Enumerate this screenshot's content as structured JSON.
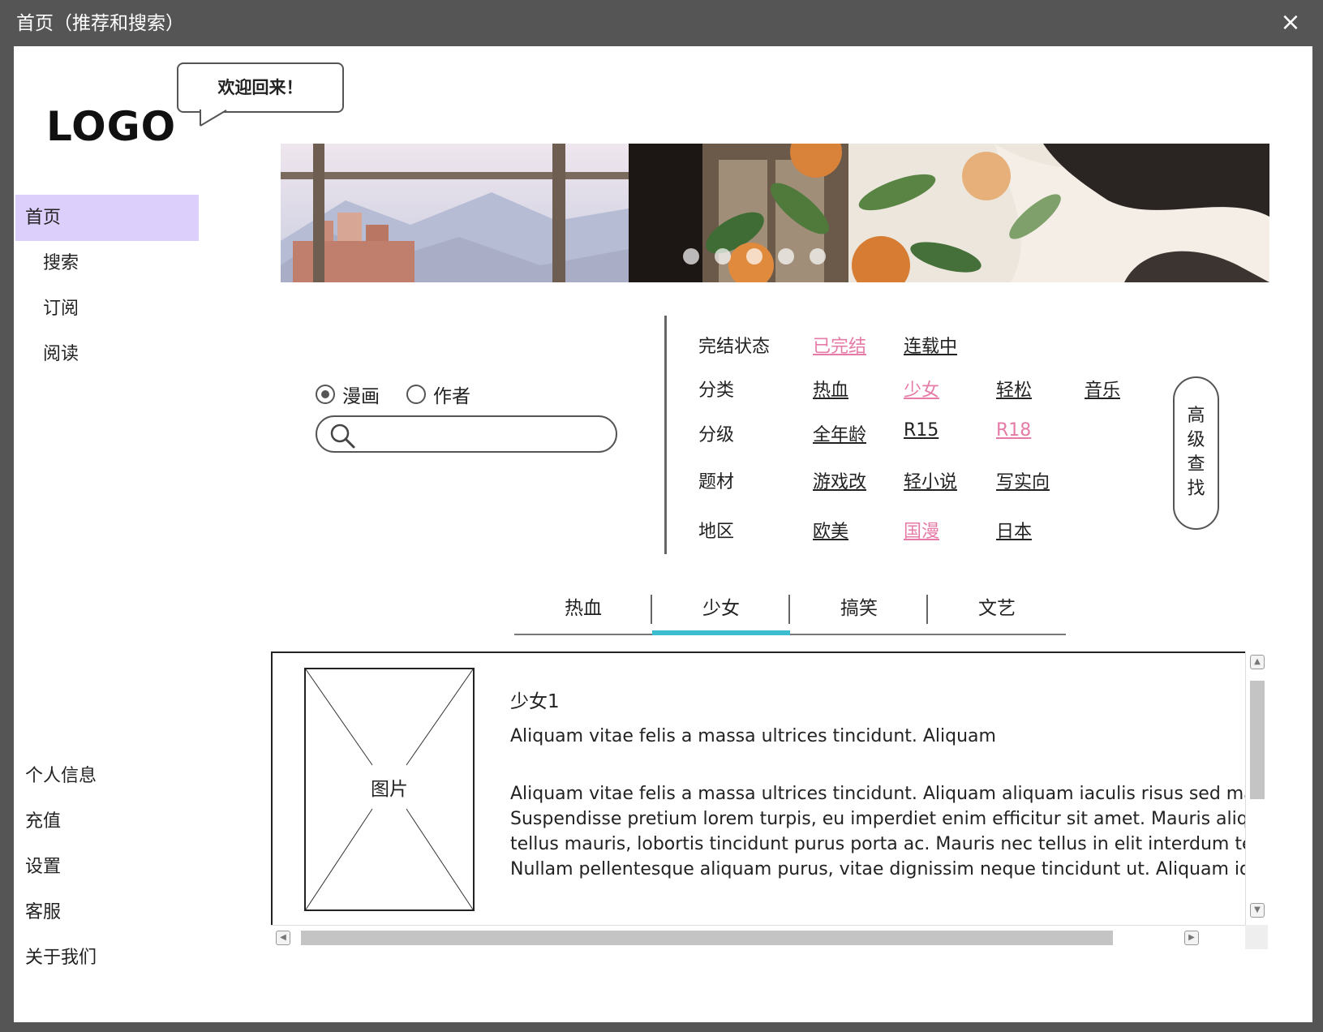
{
  "window": {
    "title": "首页（推荐和搜索）",
    "close_icon": "×"
  },
  "header": {
    "logo": "LOGO",
    "welcome": "欢迎回来！"
  },
  "sidebar": {
    "items": [
      {
        "label": "首页",
        "active": true
      },
      {
        "label": "搜索"
      },
      {
        "label": "订阅"
      },
      {
        "label": "阅读"
      }
    ],
    "bottom_items": [
      {
        "label": "个人信息"
      },
      {
        "label": "充值"
      },
      {
        "label": "设置"
      },
      {
        "label": "客服"
      },
      {
        "label": "关于我们"
      }
    ]
  },
  "banner": {
    "slides": 5,
    "active_slide": 1
  },
  "search": {
    "radio_manga": "漫画",
    "radio_author": "作者",
    "selected": "漫画",
    "placeholder": ""
  },
  "filters": {
    "rows": [
      {
        "label": "完结状态",
        "options": [
          "已完结",
          "连载中"
        ],
        "selected": [
          "已完结"
        ]
      },
      {
        "label": "分类",
        "options": [
          "热血",
          "少女",
          "轻松",
          "音乐"
        ],
        "selected": [
          "少女"
        ]
      },
      {
        "label": "分级",
        "options": [
          "全年龄",
          "R15",
          "R18"
        ],
        "selected": [
          "R18"
        ]
      },
      {
        "label": "题材",
        "options": [
          "游戏改",
          "轻小说",
          "写实向"
        ],
        "selected": []
      },
      {
        "label": "地区",
        "options": [
          "欧美",
          "国漫",
          "日本"
        ],
        "selected": [
          "国漫"
        ]
      }
    ],
    "advanced_search": [
      "高",
      "级",
      "查",
      "找"
    ],
    "highlight_color": "#e57ba6"
  },
  "tabs": {
    "items": [
      "热血",
      "少女",
      "搞笑",
      "文艺"
    ],
    "active": "少女",
    "accent_color": "#3bbccf"
  },
  "content": {
    "image_label": "图片",
    "item_title": "少女1",
    "item_subtitle": "Aliquam vitae felis a massa ultrices tincidunt. Aliquam",
    "item_body": [
      "Aliquam vitae felis a massa ultrices tincidunt. Aliquam aliquam iaculis risus sed maxim",
      "Suspendisse pretium lorem turpis, eu imperdiet enim efficitur sit amet. Mauris aliquar",
      "tellus mauris, lobortis tincidunt purus porta ac. Mauris nec tellus in elit interdum temp",
      "Nullam pellentesque aliquam purus, vitae dignissim neque tincidunt ut. Aliquam id"
    ]
  }
}
